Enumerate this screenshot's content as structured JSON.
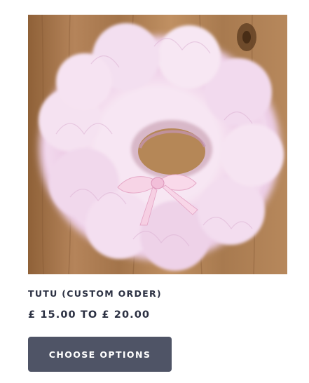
{
  "product": {
    "name": "TUTU (CUSTOM ORDER)",
    "price": "£ 15.00 TO £ 20.00",
    "button_label": "CHOOSE OPTIONS",
    "image_subject": "pink tulle tutu with ribbon bow on wooden floor"
  },
  "colors": {
    "text": "#2c3143",
    "button_bg": "#4f5466",
    "button_text": "#ffffff",
    "tulle": "#f1d6ec",
    "wood": "#a97a4c"
  }
}
